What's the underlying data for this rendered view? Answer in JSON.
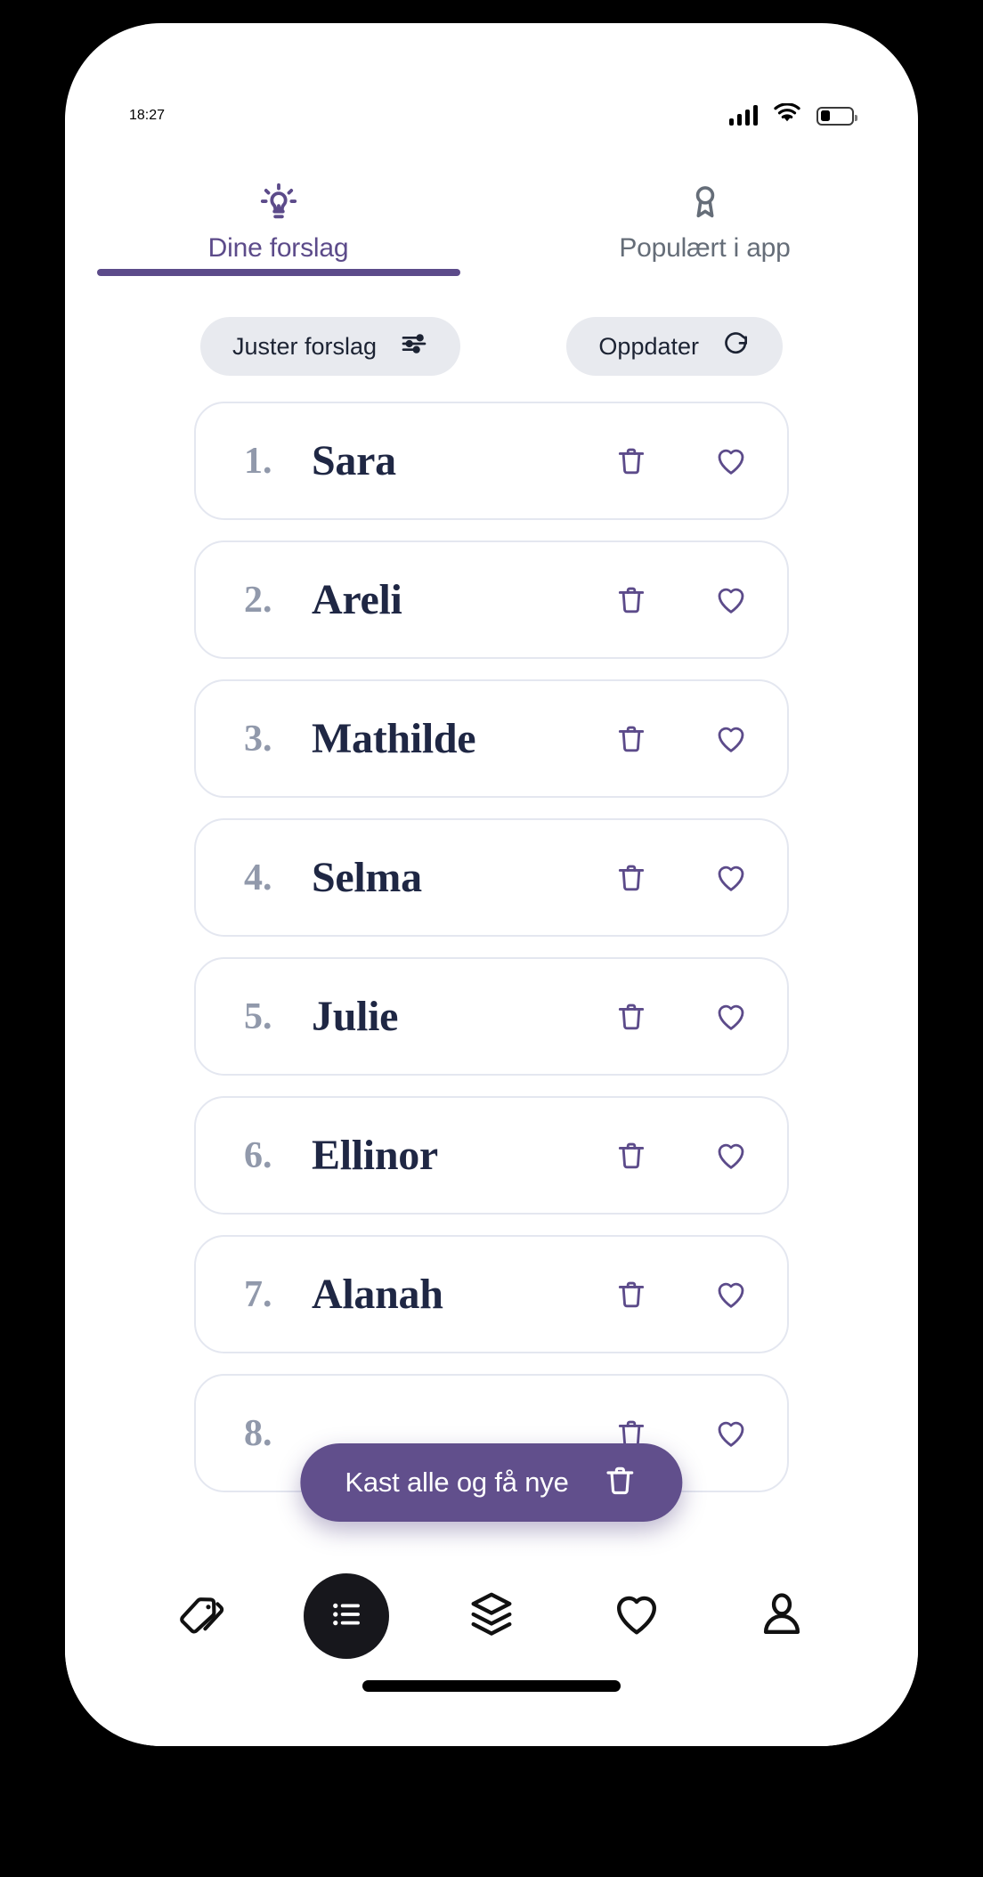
{
  "status_bar": {
    "time": "18:27",
    "signal_icon": "signal-bars-icon",
    "wifi_icon": "wifi-icon",
    "battery_icon": "battery-icon",
    "battery_level_percent": 32
  },
  "tabs": [
    {
      "label": "Dine forslag",
      "icon": "lightbulb-icon",
      "active": true
    },
    {
      "label": "Populært i app",
      "icon": "medal-icon",
      "active": false
    }
  ],
  "filters": {
    "adjust_label": "Juster forslag",
    "adjust_icon": "sliders-icon",
    "refresh_label": "Oppdater",
    "refresh_icon": "refresh-icon"
  },
  "name_list": {
    "delete_icon": "trash-icon",
    "favorite_icon": "heart-outline-icon",
    "items": [
      {
        "rank": "1.",
        "name": "Sara"
      },
      {
        "rank": "2.",
        "name": "Areli"
      },
      {
        "rank": "3.",
        "name": "Mathilde"
      },
      {
        "rank": "4.",
        "name": "Selma"
      },
      {
        "rank": "5.",
        "name": "Julie"
      },
      {
        "rank": "6.",
        "name": "Ellinor"
      },
      {
        "rank": "7.",
        "name": "Alanah"
      },
      {
        "rank": "8.",
        "name": ""
      }
    ]
  },
  "fab": {
    "label": "Kast alle og få nye",
    "icon": "trash-icon"
  },
  "bottom_nav": [
    {
      "icon": "tag-icon",
      "active": false
    },
    {
      "icon": "list-icon",
      "active": true
    },
    {
      "icon": "layers-icon",
      "active": false
    },
    {
      "icon": "heart-icon",
      "active": false
    },
    {
      "icon": "person-icon",
      "active": false
    }
  ],
  "colors": {
    "accent_purple": "#5c4b8a",
    "fab_purple": "#614f8c",
    "name_dark": "#1f2744",
    "rank_gray": "#9199ab",
    "pill_bg": "#e8eaef",
    "tab_inactive": "#656d78"
  }
}
